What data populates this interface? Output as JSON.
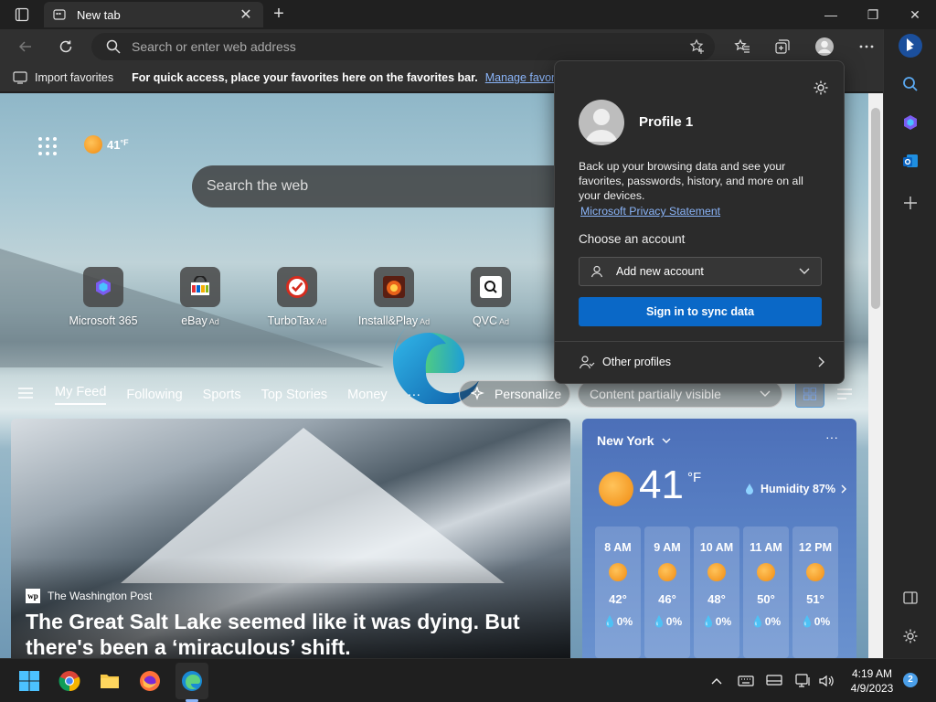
{
  "tab": {
    "title": "New tab"
  },
  "address_bar": {
    "placeholder": "Search or enter web address"
  },
  "favorites_bar": {
    "import_label": "Import favorites",
    "message": "For quick access, place your favorites here on the favorites bar.",
    "manage_link": "Manage favorites now"
  },
  "newtab": {
    "weather_temp": "41",
    "weather_unit": "°F",
    "search_placeholder": "Search the web",
    "quick_links": [
      {
        "label": "Microsoft 365",
        "ad": ""
      },
      {
        "label": "eBay",
        "ad": "Ad"
      },
      {
        "label": "TurboTax",
        "ad": "Ad"
      },
      {
        "label": "Install&Play",
        "ad": "Ad"
      },
      {
        "label": "QVC",
        "ad": "Ad"
      }
    ],
    "feed_tabs": [
      "My Feed",
      "Following",
      "Sports",
      "Top Stories",
      "Money"
    ],
    "feed_more": "···",
    "personalize_label": "Personalize",
    "content_visibility": "Content partially visible"
  },
  "news": {
    "source": "The Washington Post",
    "source_logo": "wp",
    "headline": "The Great Salt Lake seemed like it was dying. But there's been a ‘miraculous’ shift."
  },
  "weather": {
    "city": "New York",
    "temp": "41",
    "unit": "°F",
    "humidity": "Humidity 87%",
    "more": "···",
    "hourly": [
      {
        "time": "8 AM",
        "temp": "42°",
        "precip": "0%"
      },
      {
        "time": "9 AM",
        "temp": "46°",
        "precip": "0%"
      },
      {
        "time": "10 AM",
        "temp": "48°",
        "precip": "0%"
      },
      {
        "time": "11 AM",
        "temp": "50°",
        "precip": "0%"
      },
      {
        "time": "12 PM",
        "temp": "51°",
        "precip": "0%"
      }
    ]
  },
  "profile_flyout": {
    "name": "Profile 1",
    "description": "Back up your browsing data and see your favorites, passwords, history, and more on all your devices.",
    "privacy_link": "Microsoft Privacy Statement",
    "choose_account": "Choose an account",
    "add_account": "Add new account",
    "sync_button": "Sign in to sync data",
    "other_profiles": "Other profiles"
  },
  "taskbar": {
    "time": "4:19 AM",
    "date": "4/9/2023",
    "notifications": "2"
  },
  "colors": {
    "accent": "#0a68c7",
    "link": "#8ab4f8",
    "sun": "#f5a623"
  }
}
